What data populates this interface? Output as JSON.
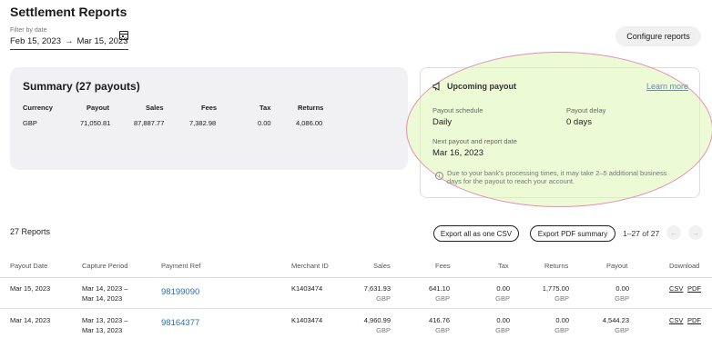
{
  "page": {
    "title": "Settlement Reports"
  },
  "filter": {
    "label": "Filter by date",
    "start": "Feb 15, 2023",
    "arrow": "→",
    "end": "Mar 15, 2023"
  },
  "configure_label": "Configure reports",
  "summary": {
    "title": "Summary (27 payouts)",
    "headers": [
      "Currency",
      "Payout",
      "Sales",
      "Fees",
      "Tax",
      "Returns"
    ],
    "row": [
      "GBP",
      "71,050.81",
      "87,887.77",
      "7,382.98",
      "0.00",
      "4,086.00"
    ]
  },
  "upcoming": {
    "title": "Upcoming payout",
    "learn_more": "Learn more",
    "schedule_label": "Payout schedule",
    "schedule_value": "Daily",
    "delay_label": "Payout delay",
    "delay_value": "0 days",
    "next_label": "Next payout and report date",
    "next_value": "Mar 16, 2023",
    "note": "Due to your bank's processing times, it may take 2–5 additional business days for the payout to reach your account.",
    "highlight_color": "#e68fb0"
  },
  "reports": {
    "count_label": "27 Reports",
    "export_csv": "Export all as one CSV",
    "export_pdf": "Export PDF summary",
    "pagination": "1–27 of 27",
    "prev": "←",
    "next": "→"
  },
  "table": {
    "headers": {
      "payout_date": "Payout Date",
      "capture_period": "Capture Period",
      "payment_ref": "Payment Ref",
      "merchant_id": "Merchant ID",
      "sales": "Sales",
      "fees": "Fees",
      "tax": "Tax",
      "returns": "Returns",
      "payout": "Payout",
      "download": "Download"
    },
    "rows": [
      {
        "payout_date": "Mar 15, 2023",
        "capture_line1": "Mar 14, 2023 –",
        "capture_line2": "Mar 14, 2023",
        "payment_ref": "98199090",
        "merchant_id": "K1403474",
        "sales": "7,631.93",
        "fees": "641.10",
        "tax": "0.00",
        "returns": "1,775.00",
        "payout": "0.00",
        "currency": "GBP",
        "csv": "CSV",
        "pdf": "PDF"
      },
      {
        "payout_date": "Mar 14, 2023",
        "capture_line1": "Mar 13, 2023 –",
        "capture_line2": "Mar 13, 2023",
        "payment_ref": "98164377",
        "merchant_id": "K1403474",
        "sales": "4,960.99",
        "fees": "416.76",
        "tax": "0.00",
        "returns": "0.00",
        "payout": "4,544.23",
        "currency": "GBP",
        "csv": "CSV",
        "pdf": "PDF"
      }
    ]
  }
}
